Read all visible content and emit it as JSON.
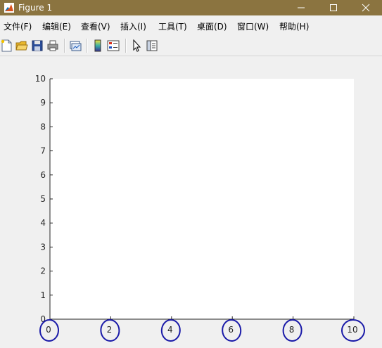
{
  "window": {
    "title": "Figure 1",
    "titlebar_color": "#8b7440"
  },
  "menu": {
    "items": [
      {
        "label": "文件(F)"
      },
      {
        "label": "编辑(E)"
      },
      {
        "label": "查看(V)"
      },
      {
        "label": "插入(I)"
      },
      {
        "label": "工具(T)"
      },
      {
        "label": "桌面(D)"
      },
      {
        "label": "窗口(W)"
      },
      {
        "label": "帮助(H)"
      }
    ]
  },
  "toolbar": {
    "buttons": [
      "new-figure-icon",
      "open-file-icon",
      "save-icon",
      "print-icon",
      "link-plot-icon",
      "insert-colorbar-icon",
      "insert-legend-icon",
      "edit-plot-arrow-icon",
      "property-inspector-icon"
    ]
  },
  "chart_data": {
    "type": "line",
    "title": "",
    "xlabel": "",
    "ylabel": "",
    "xlim": [
      0,
      10
    ],
    "ylim": [
      0,
      10
    ],
    "x_ticks": [
      "0",
      "2",
      "4",
      "6",
      "8",
      "10"
    ],
    "y_ticks": [
      "0",
      "1",
      "2",
      "3",
      "4",
      "5",
      "6",
      "7",
      "8",
      "9",
      "10"
    ],
    "series": [],
    "grid": false,
    "annotation_color": "#1a1aa8"
  }
}
